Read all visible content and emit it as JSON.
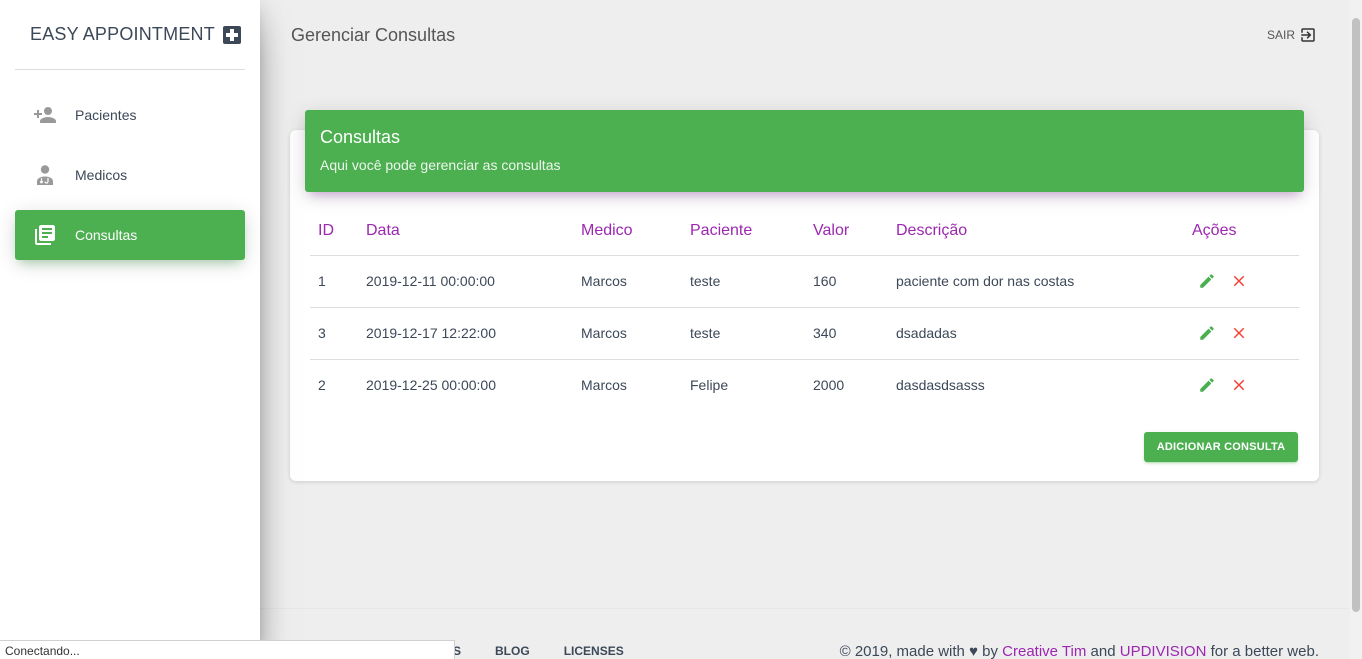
{
  "sidebar": {
    "brand": "EASY APPOINTMENT",
    "brand_icon": "medical-cross-icon",
    "items": [
      {
        "label": "Pacientes",
        "icon": "person-add-icon",
        "active": false
      },
      {
        "label": "Medicos",
        "icon": "doctor-icon",
        "active": false
      },
      {
        "label": "Consultas",
        "icon": "library-books-icon",
        "active": true
      }
    ]
  },
  "header": {
    "title": "Gerenciar Consultas",
    "logout_label": "SAIR",
    "logout_icon": "exit-to-app-icon"
  },
  "card": {
    "title": "Consultas",
    "subtitle": "Aqui você pode gerenciar as consultas",
    "columns": [
      "ID",
      "Data",
      "Medico",
      "Paciente",
      "Valor",
      "Descrição",
      "Ações"
    ],
    "rows": [
      {
        "id": "1",
        "data": "2019-12-11 00:00:00",
        "medico": "Marcos",
        "paciente": "teste",
        "valor": "160",
        "descricao": "paciente com dor nas costas"
      },
      {
        "id": "3",
        "data": "2019-12-17 12:22:00",
        "medico": "Marcos",
        "paciente": "teste",
        "valor": "340",
        "descricao": "dsadadas"
      },
      {
        "id": "2",
        "data": "2019-12-25 00:00:00",
        "medico": "Marcos",
        "paciente": "Felipe",
        "valor": "2000",
        "descricao": "dasdasdsasss"
      }
    ],
    "add_button": "ADICIONAR CONSULTA"
  },
  "footer": {
    "links": [
      "S",
      "BLOG",
      "LICENSES"
    ],
    "copyright_prefix": "© 2019, made with",
    "copyright_by": "by",
    "creative_tim": "Creative Tim",
    "and": "and",
    "updivision": "UPDIVISION",
    "suffix": "for a better web."
  },
  "status_bar": "Conectando...",
  "colors": {
    "primary": "#4caf50",
    "accent": "#9c27b0",
    "danger": "#f44336",
    "text": "#3c4858"
  }
}
